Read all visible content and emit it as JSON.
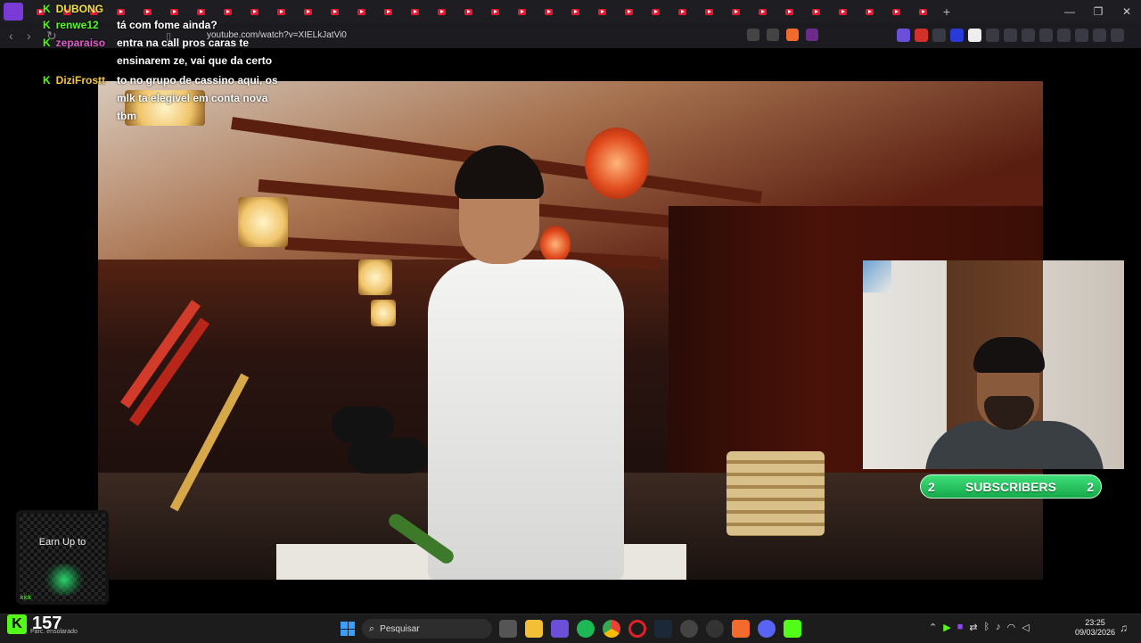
{
  "browser": {
    "url": "youtube.com/watch?v=XIELkJatVi0",
    "tab_count": 34,
    "new_tab_symbol": "+",
    "window_controls": [
      "—",
      "❐",
      "✕"
    ]
  },
  "chat": {
    "messages": [
      {
        "user": "DUBONG",
        "user_color": "#f5e342",
        "text": ""
      },
      {
        "user": "renwe12",
        "user_color": "#53fc18",
        "text": "tá com fome ainda?"
      },
      {
        "user": "zeparaiso",
        "user_color": "#e05cc7",
        "text": "entra na call pros caras te ensinarem ze, vai que da certo"
      },
      {
        "user": "DiziFrostt",
        "user_color": "#f5c542",
        "text": "to no grupo de cassino aqui, os mlk ta elegivel em conta nova tbm"
      }
    ]
  },
  "overlay": {
    "subscribers": {
      "left_count": "2",
      "label": "SUBSCRIBERS",
      "right_count": "2"
    },
    "qr": {
      "text": "Earn Up to",
      "brand": "kick"
    },
    "viewers": {
      "count": "157",
      "sub_label": "Parc. ensolarado"
    }
  },
  "taskbar": {
    "search_placeholder": "Pesquisar",
    "time": "23:25",
    "date": "09/03/2026"
  },
  "colors": {
    "kick_green": "#53fc18",
    "youtube_red": "#e8162f",
    "taskbar_bg": "#1c1c1c"
  }
}
